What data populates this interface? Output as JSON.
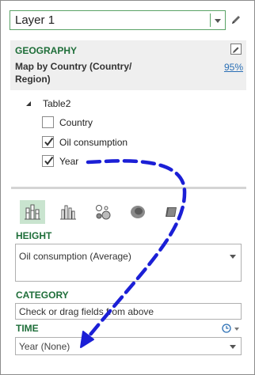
{
  "layer": {
    "selected": "Layer 1"
  },
  "geography": {
    "title": "GEOGRAPHY",
    "map_by_line1": "Map by Country (Country/",
    "map_by_line2": "Region)",
    "confidence": "95%"
  },
  "fields": {
    "table_name": "Table2",
    "items": [
      {
        "label": "Country",
        "checked": false
      },
      {
        "label": "Oil consumption",
        "checked": true
      },
      {
        "label": "Year",
        "checked": true
      }
    ]
  },
  "viz_types": [
    {
      "icon": "stacked-column-icon",
      "active": true
    },
    {
      "icon": "clustered-column-icon",
      "active": false
    },
    {
      "icon": "bubble-icon",
      "active": false
    },
    {
      "icon": "heat-map-icon",
      "active": false
    },
    {
      "icon": "region-icon",
      "active": false
    }
  ],
  "height": {
    "title": "HEIGHT",
    "value": "Oil consumption (Average)"
  },
  "category": {
    "title": "CATEGORY",
    "placeholder": "Check or drag fields from above"
  },
  "time": {
    "title": "TIME",
    "value": "Year (None)"
  },
  "colors": {
    "accent_green": "#1e6e39",
    "arrow_blue": "#1b1fd6",
    "link_blue": "#2a6fb5"
  }
}
